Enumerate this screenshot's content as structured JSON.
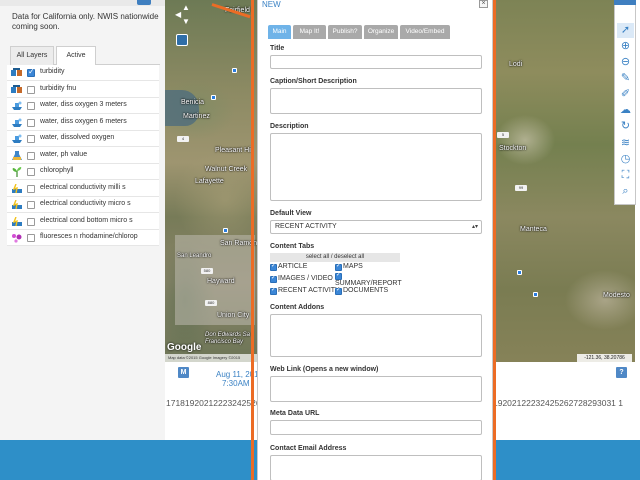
{
  "notice": "Data for California only. NWIS nationwide coming soon.",
  "layer_tabs": [
    "All Layers",
    "Active"
  ],
  "layers": [
    {
      "label": "turbidity",
      "checked": true,
      "icon": "turbidity-icon"
    },
    {
      "label": "turbidity fnu",
      "checked": false,
      "icon": "turbidity-icon"
    },
    {
      "label": "water, diss oxygen 3 meters",
      "checked": false,
      "icon": "oxygen-boat-icon"
    },
    {
      "label": "water, diss oxygen 6 meters",
      "checked": false,
      "icon": "oxygen-boat-icon"
    },
    {
      "label": "water, dissolved oxygen",
      "checked": false,
      "icon": "oxygen-boat-icon"
    },
    {
      "label": "water, ph value",
      "checked": false,
      "icon": "ph-flask-icon"
    },
    {
      "label": "chlorophyll",
      "checked": false,
      "icon": "plant-icon"
    },
    {
      "label": "electrical conductivity milli s",
      "checked": false,
      "icon": "conductivity-icon"
    },
    {
      "label": "electrical conductivity micro s",
      "checked": false,
      "icon": "conductivity-icon"
    },
    {
      "label": "electrical cond bottom micro s",
      "checked": false,
      "icon": "conductivity-icon"
    },
    {
      "label": "fluoresces n rhodamine/chlorop",
      "checked": false,
      "icon": "dye-icon"
    }
  ],
  "map_left": {
    "labels": [
      "Fairfield",
      "Benicia",
      "Martinez",
      "Pleasant Hi",
      "Walnut Creek",
      "Lafayette",
      "San Ramon",
      "Hayward",
      "Union City",
      "Don Edwards Sa Francisco Bay",
      "San Leandro"
    ],
    "attribution": "Map data ©2015 Google Imagery ©2015"
  },
  "map_right": {
    "labels": [
      "Lodi",
      "Stockton",
      "Manteca",
      "Modesto"
    ],
    "coordinate": "-121.36, 38.20786"
  },
  "timeline": {
    "m_button": "M",
    "date": "Aug 11, 2015",
    "time": "7:30AM",
    "help_button": "?",
    "days_left": "1718192021222324252627",
    "days_right": "19202122232425262728293031 1"
  },
  "modal": {
    "title": "NEW",
    "close": "×",
    "tabs": [
      "Main",
      "Map It!",
      "Publish?",
      "Organize",
      "Video/Embed"
    ],
    "active_tab": "Main",
    "fields": {
      "title": "Title",
      "caption": "Caption/Short Description",
      "description": "Description",
      "default_view": "Default View",
      "content_tabs": "Content Tabs",
      "content_addons": "Content Addons",
      "web_link": "Web Link (Opens a new window)",
      "metadata_url": "Meta Data URL",
      "contact_email": "Contact Email Address"
    },
    "default_view_value": "RECENT ACTIVITY",
    "select_all": "select all / deselect all",
    "content_tab_options": [
      {
        "label": "ARTICLE",
        "checked": true
      },
      {
        "label": "MAPS",
        "checked": true
      },
      {
        "label": "IMAGES / VIDEO",
        "checked": true
      },
      {
        "label": "SUMMARY/REPORT",
        "checked": true
      },
      {
        "label": "RECENT ACTIVITY",
        "checked": true
      },
      {
        "label": "DOCUMENTS",
        "checked": true
      }
    ]
  },
  "colors": {
    "accent": "#3b82c4",
    "orange_frame": "#ec6c25",
    "footer": "#2e8fc8",
    "tab_active": "#6fb3e8",
    "tab_inactive": "#a9a9a9"
  },
  "tools": [
    "pointer-icon",
    "zoom-in-icon",
    "zoom-out-icon",
    "ruler-icon",
    "draw-icon",
    "upload-icon",
    "refresh-icon",
    "layers-icon",
    "clock-icon",
    "fullscreen-icon",
    "search-icon"
  ]
}
